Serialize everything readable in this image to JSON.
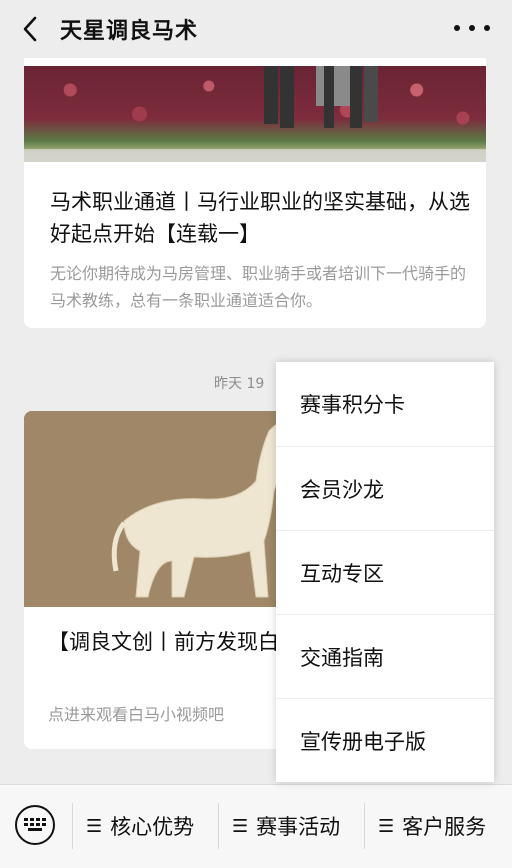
{
  "header": {
    "title": "天星调良马术",
    "back_icon": "chevron-left-icon",
    "more_icon": "more-horizontal-icon"
  },
  "articles": [
    {
      "title": "马术职业通道丨马行业职业的坚实基础，从选好起点开始【连载一】",
      "desc": "无论你期待成为马房管理、职业骑手或者培训下一代骑手的马术教练，总有一条职业通道适合你。"
    },
    {
      "time": "昨天 19",
      "title": "【调良文创丨前方发现白马】",
      "desc": "点进来观看白马小视频吧"
    }
  ],
  "menu": {
    "items": [
      "赛事积分卡",
      "会员沙龙",
      "互动专区",
      "交通指南",
      "宣传册电子版"
    ]
  },
  "bottom_bar": {
    "keyboard_icon": "keyboard-icon",
    "tabs": [
      "核心优势",
      "赛事活动",
      "客户服务"
    ]
  }
}
